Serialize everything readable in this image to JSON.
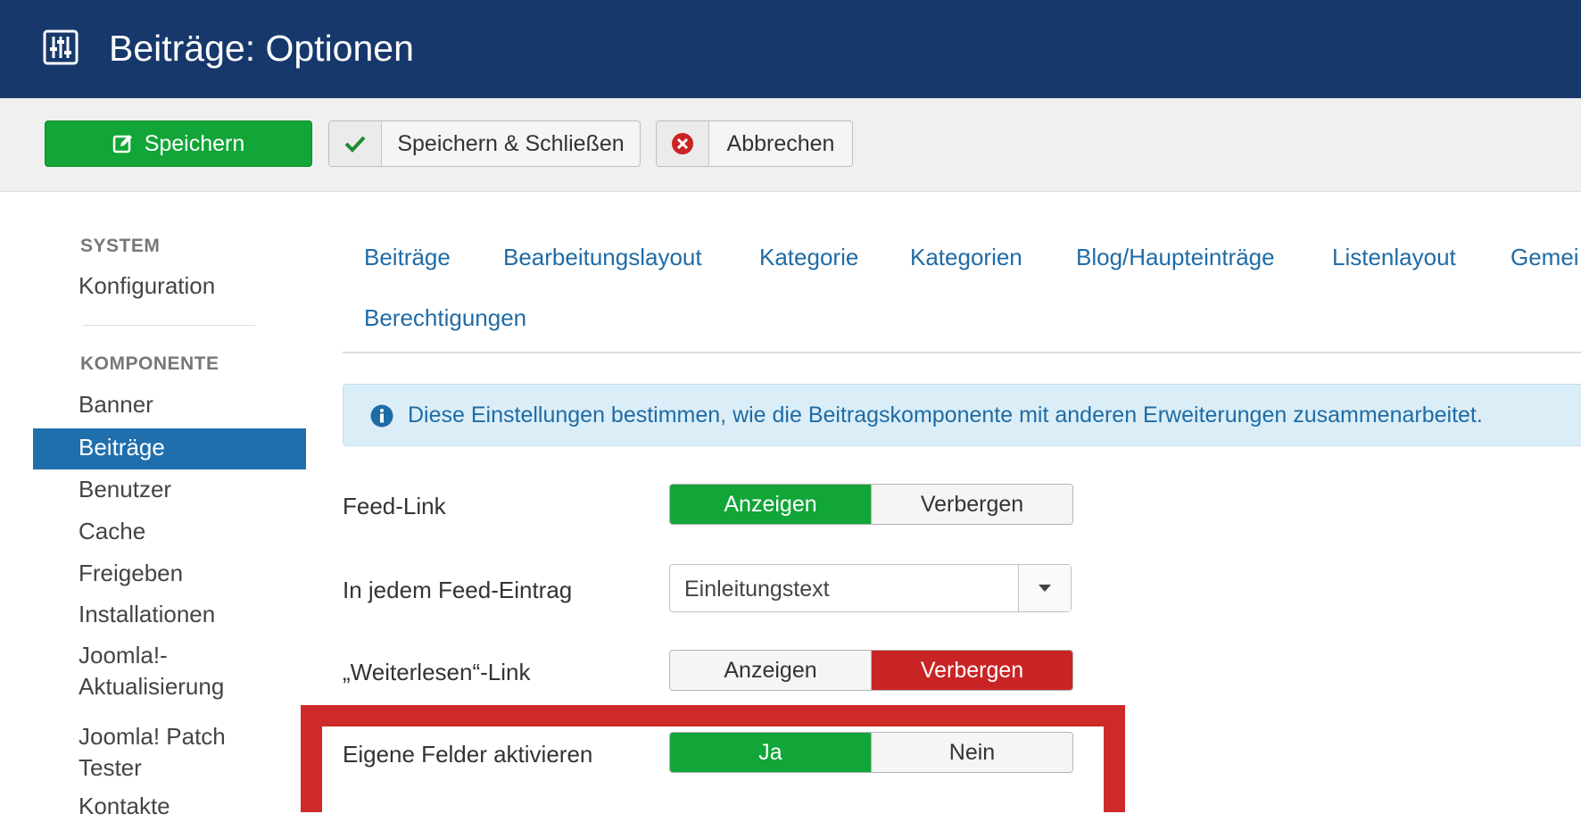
{
  "header": {
    "title": "Beiträge: Optionen",
    "icon": "sliders-icon"
  },
  "toolbar": {
    "save_label": "Speichern",
    "save_close_label": "Speichern & Schließen",
    "cancel_label": "Abbrechen"
  },
  "sidebar": {
    "system_heading": "SYSTEM",
    "system_items": [
      "Konfiguration"
    ],
    "component_heading": "KOMPONENTE",
    "items": [
      "Banner",
      "Beiträge",
      "Benutzer",
      "Cache",
      "Freigeben",
      "Installationen",
      "Joomla!-Aktualisierung",
      "Joomla! Patch Tester",
      "Kontakte"
    ],
    "item_lines": {
      "joomla_update_1": "Joomla!-",
      "joomla_update_2": "Aktualisierung",
      "patch_tester_1": "Joomla! Patch",
      "patch_tester_2": "Tester"
    },
    "active_item": "Beiträge"
  },
  "tabs": [
    "Beiträge",
    "Bearbeitungslayout",
    "Kategorie",
    "Kategorien",
    "Blog/Haupteinträge",
    "Listenlayout",
    "Gemeinsam",
    "Berechtigungen"
  ],
  "tabs_visible": {
    "gemein_clip": "Gemei"
  },
  "alert": {
    "text": "Diese Einstellungen bestimmen, wie die Beitragskomponente mit anderen Erweiterungen zusammenarbeitet."
  },
  "fields": {
    "feed_link": {
      "label": "Feed-Link",
      "options": [
        "Anzeigen",
        "Verbergen"
      ],
      "selected": "Anzeigen"
    },
    "feed_entry": {
      "label": "In jedem Feed-Eintrag",
      "value": "Einleitungstext"
    },
    "read_more": {
      "label": "„Weiterlesen“-Link",
      "options": [
        "Anzeigen",
        "Verbergen"
      ],
      "selected": "Verbergen"
    },
    "custom_fields": {
      "label": "Eigene Felder aktivieren",
      "options": [
        "Ja",
        "Nein"
      ],
      "selected": "Ja"
    }
  },
  "colors": {
    "header": "#17386b",
    "success": "#12a538",
    "danger": "#c92424",
    "link": "#1f6ba6",
    "active_nav": "#1f6fad",
    "highlight": "#cf2a2a"
  }
}
